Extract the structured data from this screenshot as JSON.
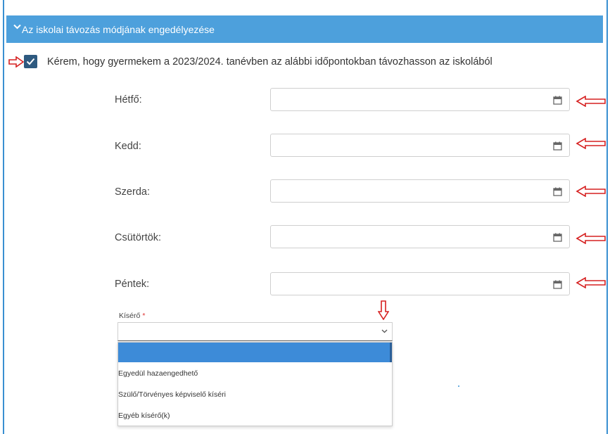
{
  "section": {
    "title": "Az iskolai távozás módjának engedélyezése",
    "header_color": "#4da0dc"
  },
  "consent": {
    "checked": true,
    "text": "Kérem, hogy gyermekem a 2023/2024. tanévben az alábbi időpontokban távozhasson az iskolából"
  },
  "days": [
    {
      "label": "Hétfő:",
      "value": ""
    },
    {
      "label": "Kedd:",
      "value": ""
    },
    {
      "label": "Szerda:",
      "value": ""
    },
    {
      "label": "Csütörtök:",
      "value": ""
    },
    {
      "label": "Péntek:",
      "value": ""
    }
  ],
  "companion": {
    "label": "Kísérő",
    "required_mark": "*",
    "value": "",
    "options": [
      "",
      "Egyedül hazaengedhető",
      "Szülő/Törvényes képviselő kíséri",
      "Egyéb kísérő(k)"
    ],
    "highlight_color": "#3d8bd8"
  },
  "annotation_color": "#d62020"
}
